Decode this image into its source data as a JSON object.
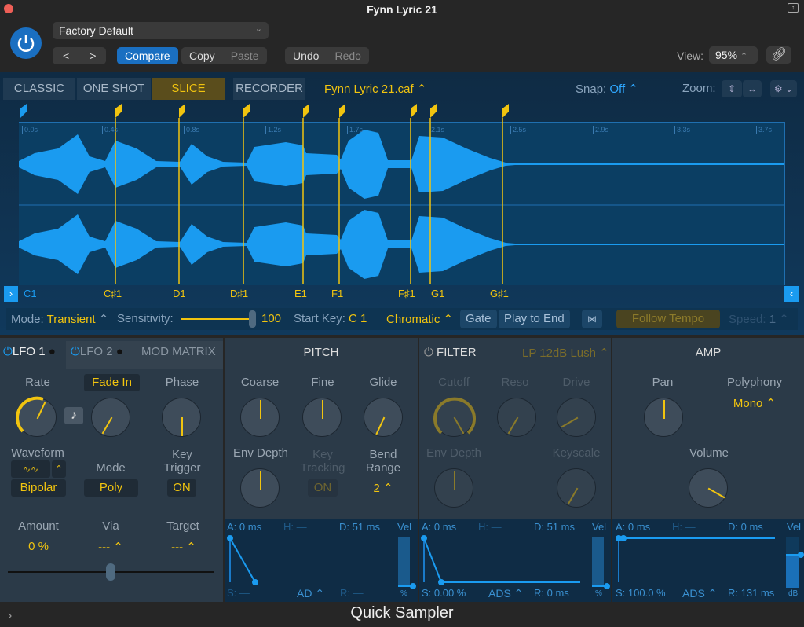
{
  "window": {
    "title": "Fynn Lyric 21",
    "plugin_name": "Quick Sampler"
  },
  "header": {
    "preset": "Factory Default",
    "prev_label": "<",
    "next_label": ">",
    "compare_label": "Compare",
    "copy_label": "Copy",
    "paste_label": "Paste",
    "undo_label": "Undo",
    "redo_label": "Redo",
    "view_label": "View:",
    "view_value": "95%"
  },
  "modes": {
    "tabs": [
      {
        "label": "CLASSIC"
      },
      {
        "label": "ONE SHOT"
      },
      {
        "label": "SLICE",
        "active": true
      },
      {
        "label": "RECORDER"
      }
    ],
    "filename": "Fynn Lyric 21.caf ⌃",
    "snap_label": "Snap:",
    "snap_value": "Off",
    "zoom_label": "Zoom:"
  },
  "waveform": {
    "time_ticks": [
      "0.0s",
      "0.4s",
      "0.8s",
      "1.2s",
      "1.7s",
      "2.1s",
      "2.5s",
      "2.9s",
      "3.3s",
      "3.7s"
    ],
    "slice_keys": [
      "C1",
      "C♯1",
      "D1",
      "D♯1",
      "E1",
      "F1",
      "F♯1",
      "G1",
      "G♯1"
    ],
    "accent_color": "#1a9bf0",
    "marker_color": "#f1c40f"
  },
  "slice_bar": {
    "mode_label": "Mode:",
    "mode_value": "Transient",
    "sensitivity_label": "Sensitivity:",
    "sensitivity_value": "100",
    "start_key_label": "Start Key:",
    "start_key_value": "C 1",
    "scale": "Chromatic",
    "gate_label": "Gate",
    "play_to_end_label": "Play to End",
    "follow_tempo_label": "Follow Tempo",
    "speed_label": "Speed:",
    "speed_value": "1"
  },
  "lfo": {
    "tab1": "LFO 1",
    "tab2": "LFO 2",
    "tab3": "MOD MATRIX",
    "rate_label": "Rate",
    "fade_in_label": "Fade In",
    "phase_label": "Phase",
    "waveform_label": "Waveform",
    "waveform_value": "Bipolar",
    "mode_label": "Mode",
    "mode_value": "Poly",
    "key_trigger_label": "Key Trigger",
    "key_trigger_value": "ON",
    "amount_label": "Amount",
    "amount_value": "0 %",
    "via_label": "Via",
    "via_value": "--- ⌃",
    "target_label": "Target",
    "target_value": "--- ⌃"
  },
  "pitch": {
    "title": "PITCH",
    "coarse_label": "Coarse",
    "fine_label": "Fine",
    "glide_label": "Glide",
    "env_depth_label": "Env Depth",
    "key_tracking_label": "Key Tracking",
    "key_tracking_value": "ON",
    "bend_range_label": "Bend Range",
    "bend_range_value": "2 ⌃",
    "env": {
      "a": "A: 0 ms",
      "h": "H: —",
      "d": "D: 51 ms",
      "s": "S: —",
      "r": "R: —",
      "type": "AD ⌃",
      "vel": "Vel",
      "unit": "%"
    }
  },
  "filter": {
    "title": "FILTER",
    "type": "LP 12dB Lush ⌃",
    "cutoff_label": "Cutoff",
    "reso_label": "Reso",
    "drive_label": "Drive",
    "env_depth_label": "Env Depth",
    "keyscale_label": "Keyscale",
    "env": {
      "a": "A: 0 ms",
      "h": "H: —",
      "d": "D: 51 ms",
      "s": "S: 0.00 %",
      "r": "R: 0 ms",
      "type": "ADS ⌃",
      "vel": "Vel",
      "unit": "%"
    }
  },
  "amp": {
    "title": "AMP",
    "pan_label": "Pan",
    "polyphony_label": "Polyphony",
    "polyphony_value": "Mono ⌃",
    "volume_label": "Volume",
    "env": {
      "a": "A: 0 ms",
      "h": "H: —",
      "d": "D: 0 ms",
      "s": "S: 100.0 %",
      "r": "R: 131 ms",
      "type": "ADS ⌃",
      "vel": "Vel",
      "unit": "dB"
    }
  }
}
